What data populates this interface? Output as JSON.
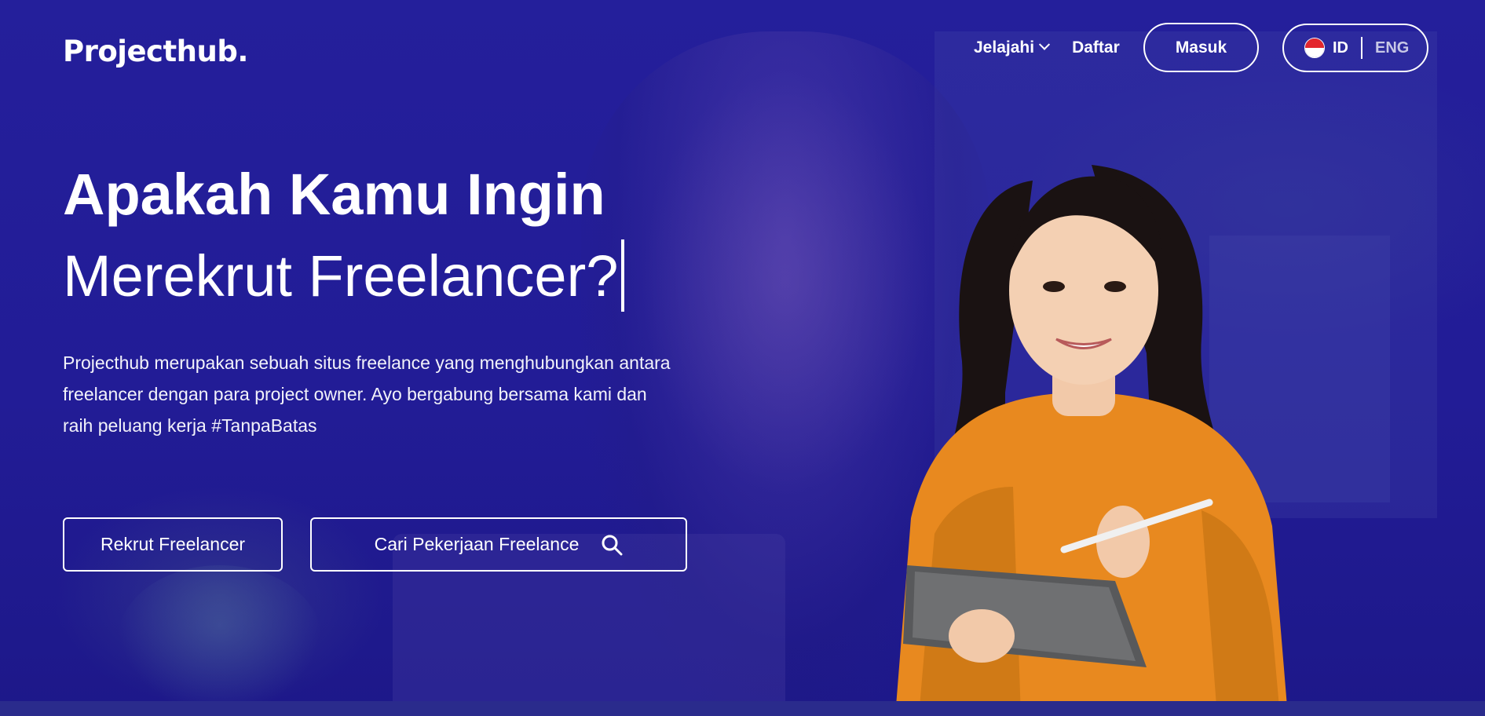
{
  "brand": {
    "logo_text": "Projecthub."
  },
  "nav": {
    "explore_label": "Jelajahi",
    "register_label": "Daftar",
    "login_label": "Masuk",
    "language": {
      "active": "ID",
      "other": "ENG"
    }
  },
  "hero": {
    "title_bold": "Apakah Kamu Ingin",
    "title_light": "Merekrut Freelancer?",
    "description": "Projecthub merupakan sebuah situs freelance yang menghubungkan antara freelancer dengan para project owner. Ayo bergabung bersama kami dan raih peluang kerja #TanpaBatas",
    "primary_button": "Rekrut Freelancer",
    "secondary_button": "Cari Pekerjaan Freelance"
  },
  "colors": {
    "overlay": "#1e1a8f",
    "text": "#ffffff",
    "sweater": "#e8891f",
    "flag_red": "#e3262d"
  },
  "icons": [
    "chevron-down-icon",
    "indonesia-flag-icon",
    "search-icon"
  ]
}
